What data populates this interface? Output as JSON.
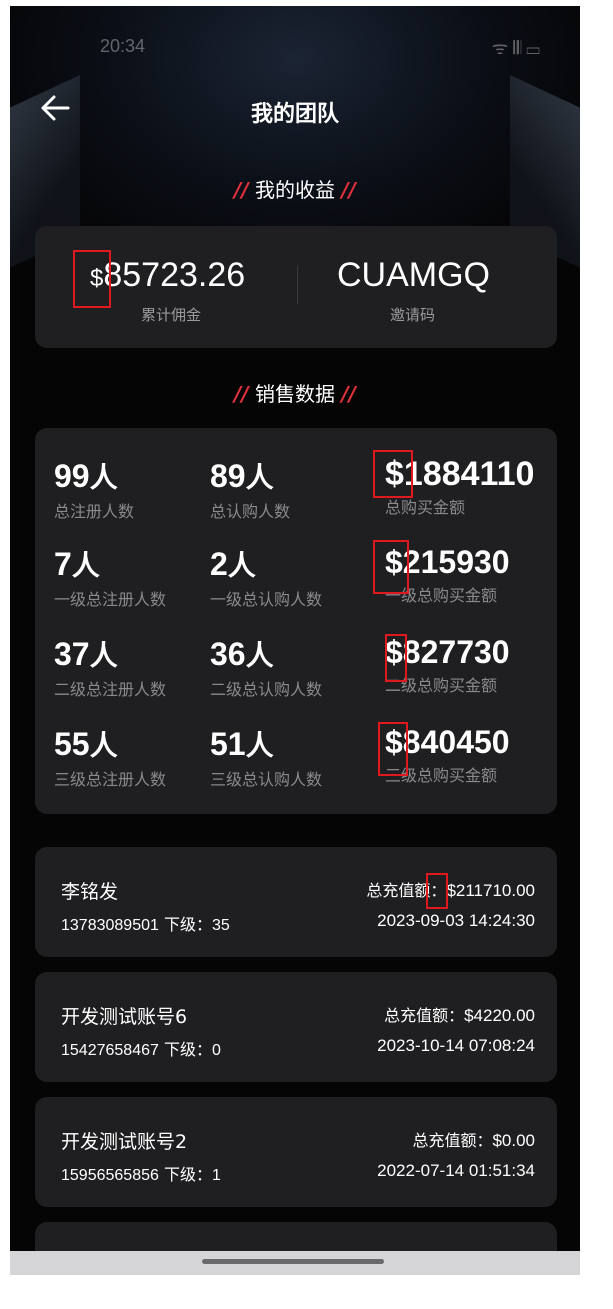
{
  "status_bar": {
    "time": "20:34",
    "signal": "ᯤ 𝄃𝄃 ▭"
  },
  "header": {
    "title": "我的团队",
    "back_icon": "arrow-left-icon"
  },
  "earnings": {
    "section_title": "我的收益",
    "slash": "//",
    "currency": "$",
    "amount": "85723.26",
    "amount_label": "累计佣金",
    "invite_code": "CUAMGQ",
    "invite_label": "邀请码"
  },
  "sales": {
    "section_title": "销售数据",
    "unit": "人",
    "rows": [
      {
        "reg": "99",
        "reg_label": "总注册人数",
        "sub": "89",
        "sub_label": "总认购人数",
        "amount": "$1884110",
        "amount_label": "总购买金额"
      },
      {
        "reg": "7",
        "reg_label": "一级总注册人数",
        "sub": "2",
        "sub_label": "一级总认购人数",
        "amount": "$215930",
        "amount_label": "一级总购买金额"
      },
      {
        "reg": "37",
        "reg_label": "二级总注册人数",
        "sub": "36",
        "sub_label": "二级总认购人数",
        "amount": "$827730",
        "amount_label": "二级总购买金额"
      },
      {
        "reg": "55",
        "reg_label": "三级总注册人数",
        "sub": "51",
        "sub_label": "三级总认购人数",
        "amount": "$840450",
        "amount_label": "三级总购买金额"
      }
    ]
  },
  "members": [
    {
      "name": "李铭发",
      "phone": "13783089501",
      "sub_label": "下级：",
      "sub_count": "35",
      "total_label": "总充值额：",
      "total": "$211710.00",
      "time": "2023-09-03 14:24:30"
    },
    {
      "name": "开发测试账号6",
      "phone": "15427658467",
      "sub_label": "下级：",
      "sub_count": "0",
      "total_label": "总充值额：",
      "total": "$4220.00",
      "time": "2023-10-14 07:08:24"
    },
    {
      "name": "开发测试账号2",
      "phone": "15956565856",
      "sub_label": "下级：",
      "sub_count": "1",
      "total_label": "总充值额：",
      "total": "$0.00",
      "time": "2022-07-14 01:51:34"
    }
  ],
  "colors": {
    "accent": "#e0323c",
    "card": "#1f1f22",
    "background": "#050506"
  }
}
